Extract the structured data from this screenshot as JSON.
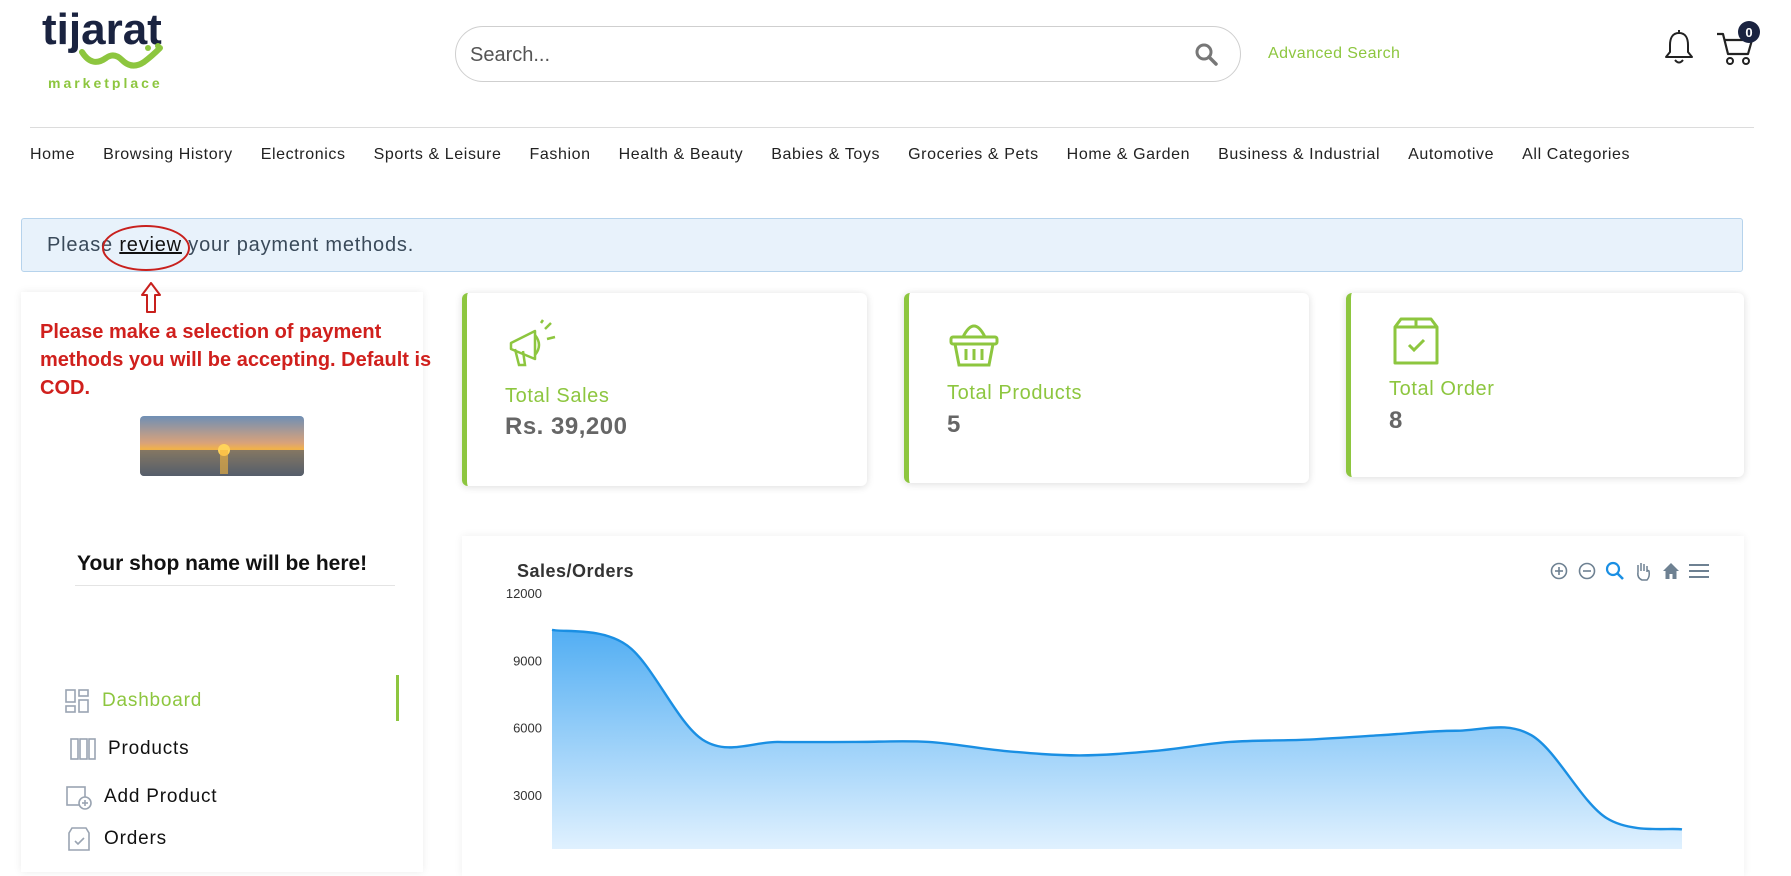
{
  "header": {
    "logo_text": "tijarat",
    "logo_sub": "marketplace",
    "search_placeholder": "Search...",
    "advanced_search": "Advanced Search",
    "cart_count": "0"
  },
  "nav": [
    "Home",
    "Browsing History",
    "Electronics",
    "Sports & Leisure",
    "Fashion",
    "Health & Beauty",
    "Babies & Toys",
    "Groceries & Pets",
    "Home & Garden",
    "Business & Industrial",
    "Automotive",
    "All Categories"
  ],
  "alert": {
    "before": "Please ",
    "link": "review",
    "after": " your payment methods."
  },
  "annotation": {
    "note": "Please make a selection of payment methods you will be accepting. Default is COD."
  },
  "sidebar": {
    "shop_name": "Your shop name will be here!",
    "items": [
      {
        "label": "Dashboard",
        "icon": "dashboard-icon",
        "active": true
      },
      {
        "label": "Products",
        "icon": "products-icon",
        "active": false
      },
      {
        "label": "Add Product",
        "icon": "add-product-icon",
        "active": false
      },
      {
        "label": "Orders",
        "icon": "orders-icon",
        "active": false
      }
    ]
  },
  "stats": [
    {
      "label": "Total Sales",
      "value": "Rs. 39,200",
      "icon": "megaphone-icon"
    },
    {
      "label": "Total Products",
      "value": "5",
      "icon": "basket-icon"
    },
    {
      "label": "Total Order",
      "value": "8",
      "icon": "box-icon"
    }
  ],
  "colors": {
    "accent": "#8dc63f",
    "brand_dark": "#1a2340",
    "alert_bg": "#e8f2fb",
    "chart_line": "#1a8fe3"
  },
  "chart_data": {
    "type": "area",
    "title": "Sales/Orders",
    "yticks": [
      "12000",
      "9000",
      "6000",
      "3000"
    ],
    "ylim": [
      0,
      12000
    ],
    "series": [
      {
        "values": [
          10400,
          9700,
          5500,
          5400,
          5400,
          5400,
          5000,
          4800,
          5000,
          5400,
          5500,
          5700,
          5900,
          5700,
          2000,
          1500
        ]
      }
    ],
    "toolbar": [
      "zoom-in-icon",
      "zoom-out-icon",
      "zoom-select-icon",
      "pan-icon",
      "home-icon",
      "menu-icon"
    ]
  }
}
